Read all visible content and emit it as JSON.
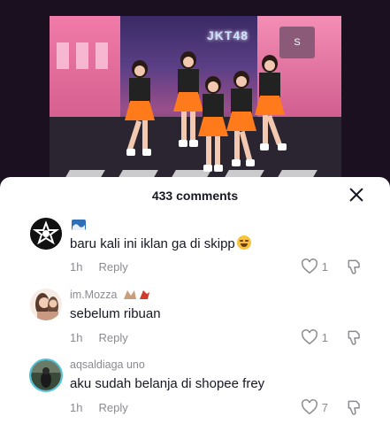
{
  "sheet": {
    "comment_count": "433 comments"
  },
  "video": {
    "sign_text": "JKT48",
    "shop_text": "S"
  },
  "comments": [
    {
      "username": "",
      "username_icon": "wave-flag-icon",
      "text": "baru kali ini iklan ga di skipp",
      "text_emoji": "grinning-sweat-emoji",
      "time": "1h",
      "reply_label": "Reply",
      "likes": "1"
    },
    {
      "username": "im.Mozza",
      "username_icon": "fox-leaf-emoji",
      "text": "sebelum ribuan",
      "time": "1h",
      "reply_label": "Reply",
      "likes": "1"
    },
    {
      "username": "aqsaldiaga uno",
      "text": "aku sudah belanja di shopee frey",
      "time": "1h",
      "reply_label": "Reply",
      "likes": "7"
    }
  ],
  "colors": {
    "text_primary": "#161823",
    "text_secondary": "#8a8b91",
    "skirt_orange": "#ff7a1a"
  }
}
